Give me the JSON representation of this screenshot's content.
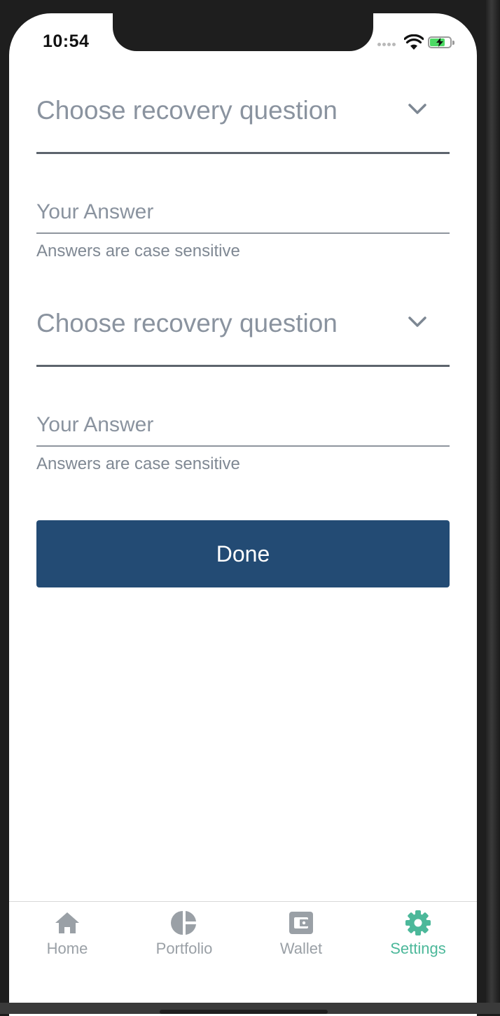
{
  "status_bar": {
    "time": "10:54"
  },
  "form": {
    "questions": [
      {
        "select_label": "Choose recovery question",
        "answer_placeholder": "Your Answer",
        "hint": "Answers are case sensitive"
      },
      {
        "select_label": "Choose recovery question",
        "answer_placeholder": "Your Answer",
        "hint": "Answers are case sensitive"
      }
    ],
    "done_label": "Done"
  },
  "tab_bar": {
    "items": [
      {
        "label": "Home",
        "icon": "home-icon",
        "active": false
      },
      {
        "label": "Portfolio",
        "icon": "pie-chart-icon",
        "active": false
      },
      {
        "label": "Wallet",
        "icon": "wallet-icon",
        "active": false
      },
      {
        "label": "Settings",
        "icon": "gear-icon",
        "active": true
      }
    ]
  },
  "colors": {
    "primary_button": "#234b74",
    "active_tab": "#4cb89a",
    "inactive_tab": "#9aa0a6",
    "placeholder_text": "#8a939f"
  }
}
